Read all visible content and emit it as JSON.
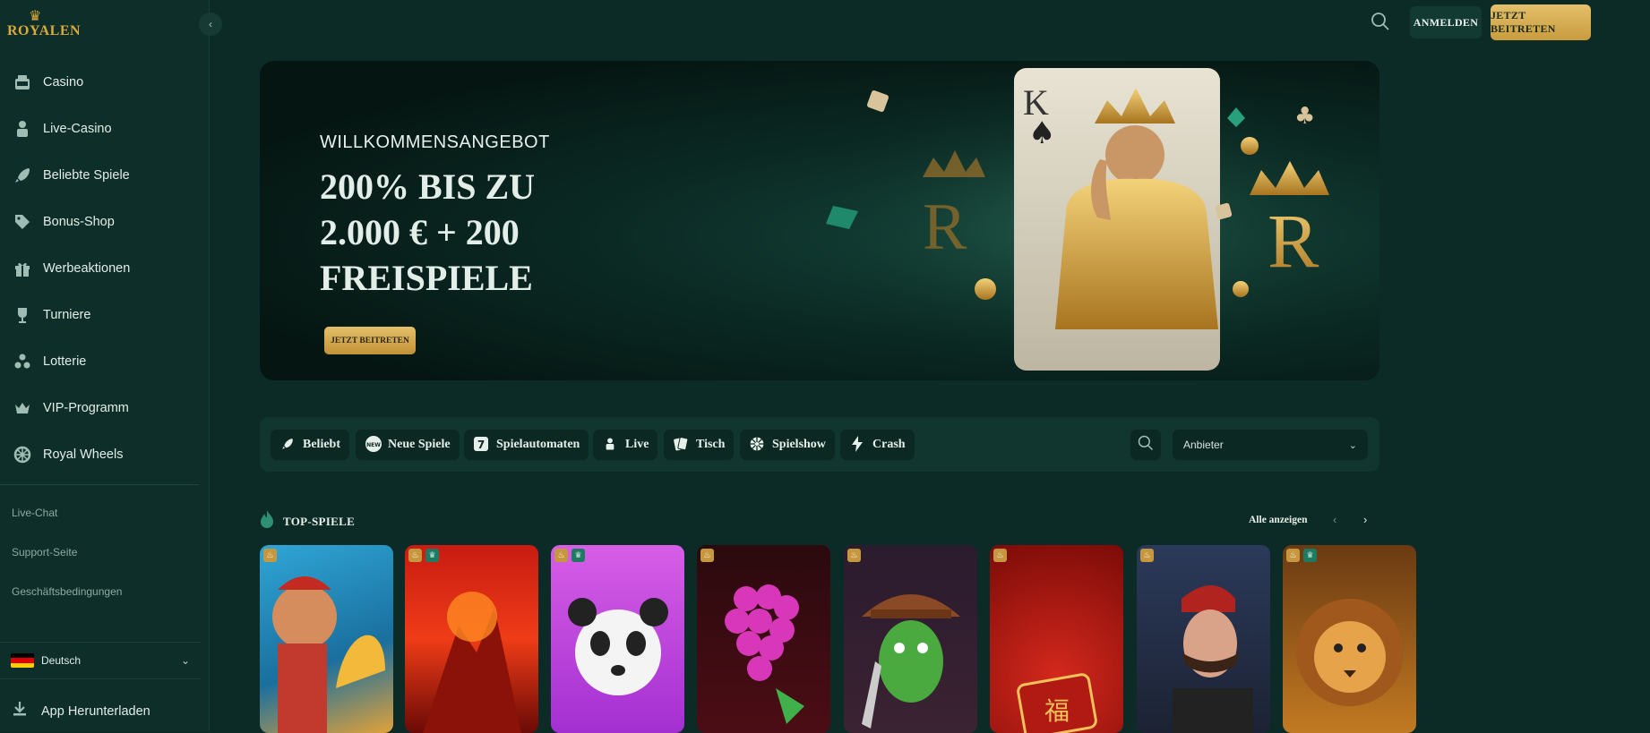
{
  "brand": {
    "name": "ROYALEN"
  },
  "sidebar": {
    "items": [
      {
        "label": "Casino",
        "icon": "slot-machine-icon"
      },
      {
        "label": "Live-Casino",
        "icon": "dealer-icon"
      },
      {
        "label": "Beliebte Spiele",
        "icon": "rocket-icon"
      },
      {
        "label": "Bonus-Shop",
        "icon": "tag-icon"
      },
      {
        "label": "Werbeaktionen",
        "icon": "gift-icon"
      },
      {
        "label": "Turniere",
        "icon": "trophy-icon"
      },
      {
        "label": "Lotterie",
        "icon": "lottery-balls-icon"
      },
      {
        "label": "VIP-Programm",
        "icon": "crown-icon"
      },
      {
        "label": "Royal Wheels",
        "icon": "wheel-icon"
      }
    ],
    "links": [
      "Live-Chat",
      "Support-Seite",
      "Geschäftsbedingungen"
    ],
    "language": "Deutsch",
    "app_download": "App Herunterladen"
  },
  "header": {
    "login_label": "ANMELDEN",
    "join_label": "JETZT BEITRETEN"
  },
  "hero": {
    "eyebrow": "WILLKOMMENSANGEBOT",
    "headline_line1": "200% BIS ZU",
    "headline_line2": "2.000 € + 200",
    "headline_line3": "FREISPIELE",
    "cta_label": "JETZT BEITRETEN"
  },
  "filters": {
    "chips": [
      {
        "label": "Beliebt",
        "icon": "rocket-icon"
      },
      {
        "label": "Neue Spiele",
        "icon": "new-badge-icon"
      },
      {
        "label": "Spielautomaten",
        "icon": "seven-icon"
      },
      {
        "label": "Live",
        "icon": "dealer-icon"
      },
      {
        "label": "Tisch",
        "icon": "cards-icon"
      },
      {
        "label": "Spielshow",
        "icon": "wheel-icon"
      },
      {
        "label": "Crash",
        "icon": "lightning-icon"
      }
    ],
    "provider_placeholder": "Anbieter"
  },
  "top_games": {
    "title": "TOP-SPIELE",
    "view_all": "Alle anzeigen"
  },
  "colors": {
    "background": "#0c2b26",
    "sidebar": "#0e2f29",
    "gold": "#d9a93a",
    "accent_green": "#2f8f74"
  }
}
